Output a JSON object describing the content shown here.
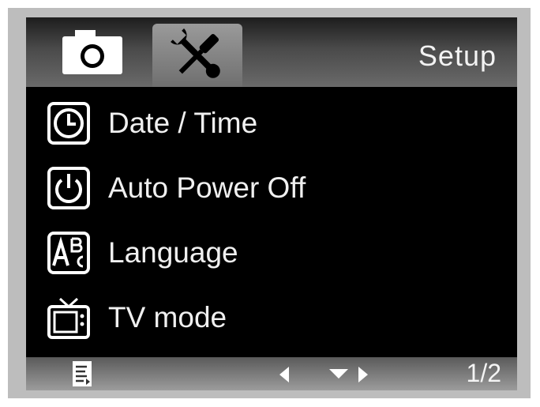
{
  "header": {
    "title": "Setup",
    "tabs": [
      {
        "icon": "camera-icon",
        "active": false
      },
      {
        "icon": "tools-icon",
        "active": true
      }
    ]
  },
  "menu": {
    "items": [
      {
        "label": "Date / Time",
        "icon": "clock-icon"
      },
      {
        "label": "Auto Power Off",
        "icon": "power-icon"
      },
      {
        "label": "Language",
        "icon": "language-icon"
      },
      {
        "label": "TV mode",
        "icon": "tv-icon"
      }
    ]
  },
  "footer": {
    "page": "1/2",
    "icons": [
      "menu-list-icon",
      "left-arrow-icon",
      "down-arrow-icon",
      "right-arrow-icon"
    ]
  },
  "colors": {
    "background": "#000000",
    "text": "#f0f0f0",
    "bar": "#6a6a6a"
  }
}
